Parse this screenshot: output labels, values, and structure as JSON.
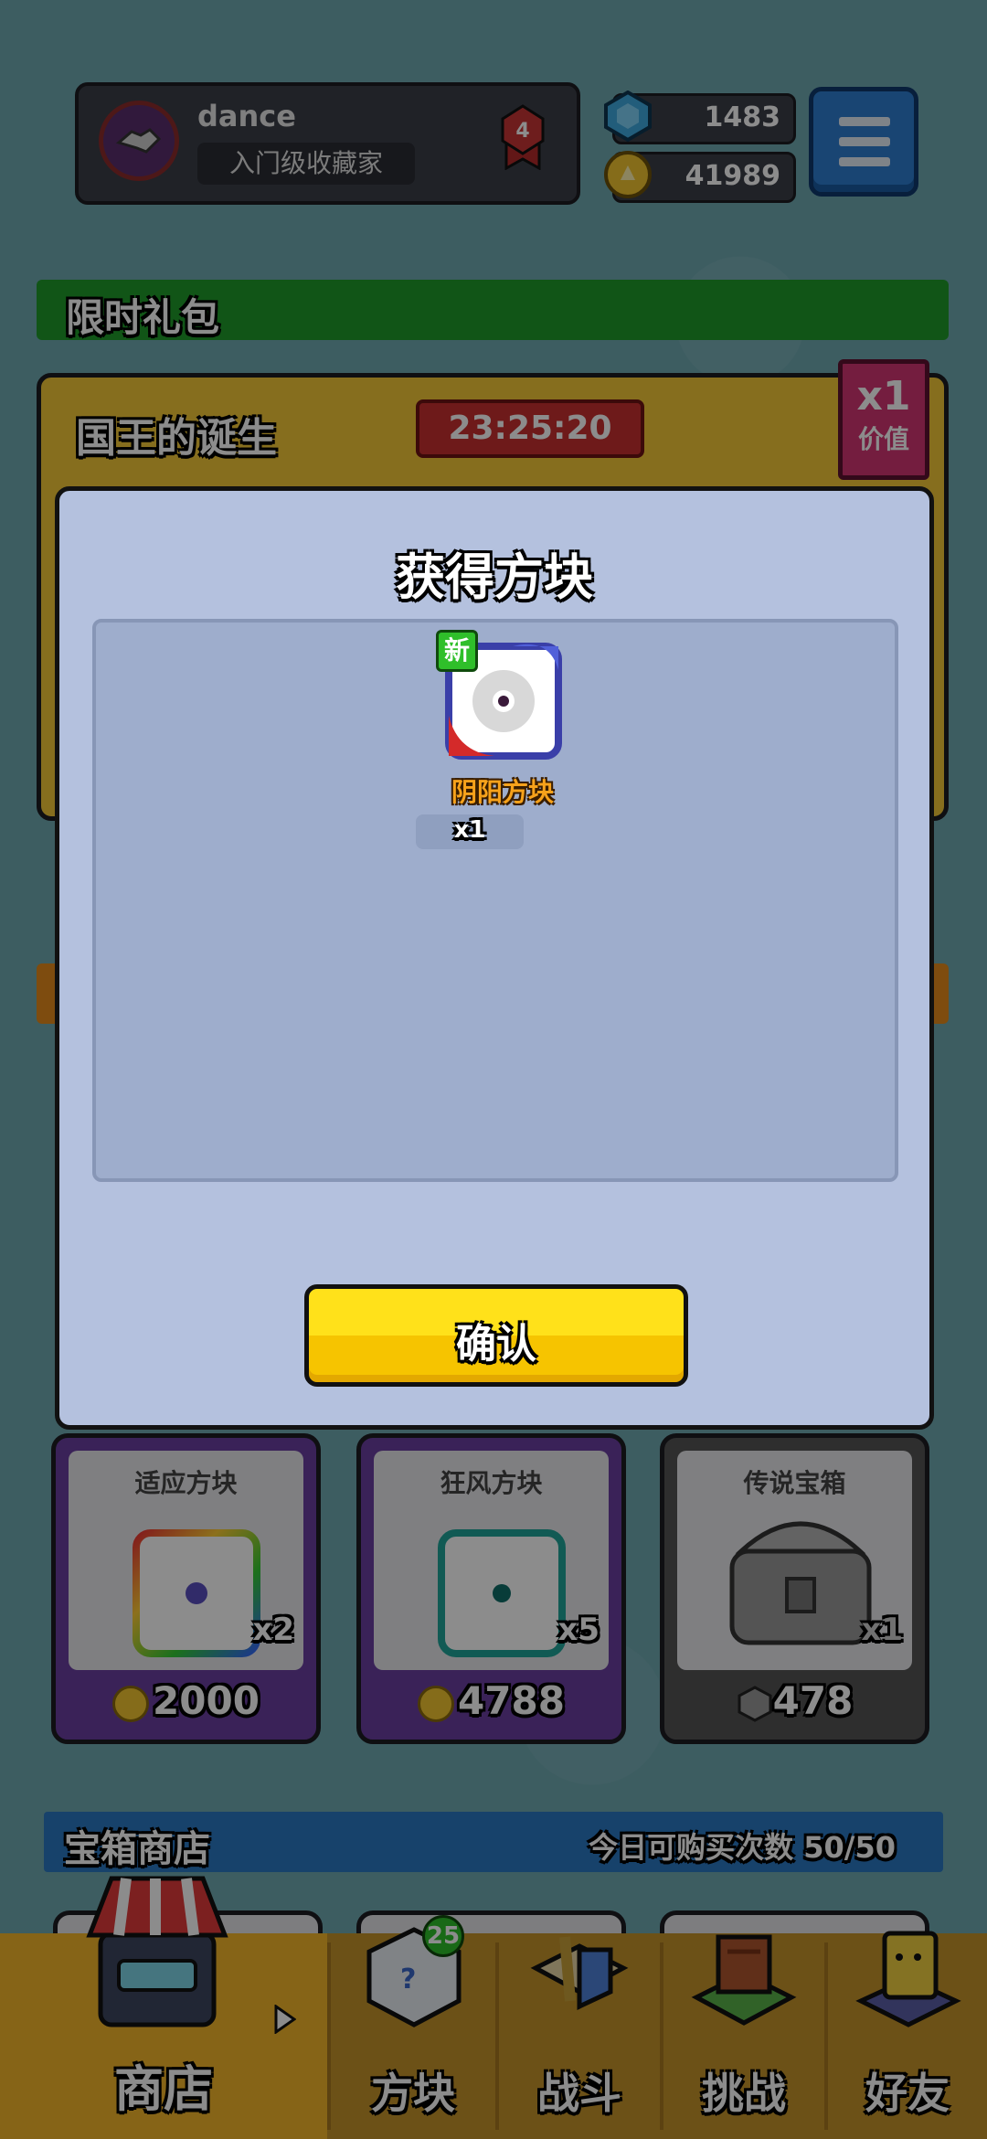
{
  "profile": {
    "username": "dance",
    "rank_title": "入门级收藏家",
    "rank_level": "4"
  },
  "currency": {
    "gems": "1483",
    "coins": "41989"
  },
  "sections": {
    "limited_gift": "限时礼包",
    "chest_shop": "宝箱商店",
    "daily_purchase": "今日可购买次数",
    "daily_purchase_count": "50/50"
  },
  "king_offer": {
    "title": "国王的诞生",
    "timer": "23:25:20",
    "value_multiplier": "x1",
    "value_label": "价值"
  },
  "products": [
    {
      "name": "适应方块",
      "qty": "x2",
      "price": "2000",
      "currency": "coin"
    },
    {
      "name": "狂风方块",
      "qty": "x5",
      "price": "4788",
      "currency": "coin"
    },
    {
      "name": "传说宝箱",
      "qty": "x1",
      "price": "478",
      "currency": "gem"
    }
  ],
  "modal": {
    "title": "获得方块",
    "reward_name": "阴阳方块",
    "reward_qty": "x1",
    "new_badge": "新",
    "confirm_label": "确认"
  },
  "nav": {
    "shop": "商店",
    "blocks": "方块",
    "blocks_badge": "25",
    "battle": "战斗",
    "challenge": "挑战",
    "friends": "好友"
  },
  "colors": {
    "confirm_yellow": "#ffe11a",
    "modal_bg": "#b4c1de",
    "shop_tab": "#f4b62a"
  }
}
